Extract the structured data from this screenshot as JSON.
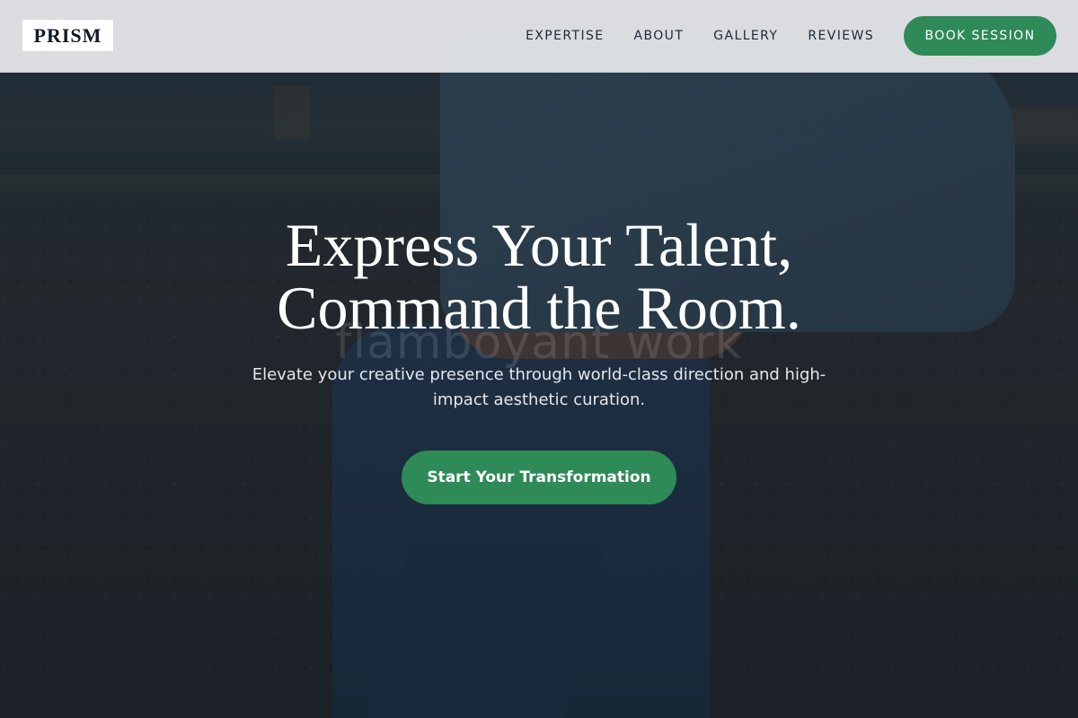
{
  "brand": {
    "logo_text": "PRISM"
  },
  "nav": {
    "links": [
      "EXPERTISE",
      "ABOUT",
      "GALLERY",
      "REVIEWS"
    ],
    "cta_label": "BOOK SESSION"
  },
  "hero": {
    "title_line1": "Express Your Talent,",
    "title_line2": "Command the Room.",
    "subtitle": "Elevate your creative presence through world-class direction and high-impact aesthetic curation.",
    "cta_label": "Start Your Transformation",
    "background_watermark": "flamboyant work"
  },
  "colors": {
    "accent": "#2e8a57",
    "header_bg": "#e2e4e6",
    "text_dark": "#1f2937",
    "text_light": "#ffffff"
  }
}
